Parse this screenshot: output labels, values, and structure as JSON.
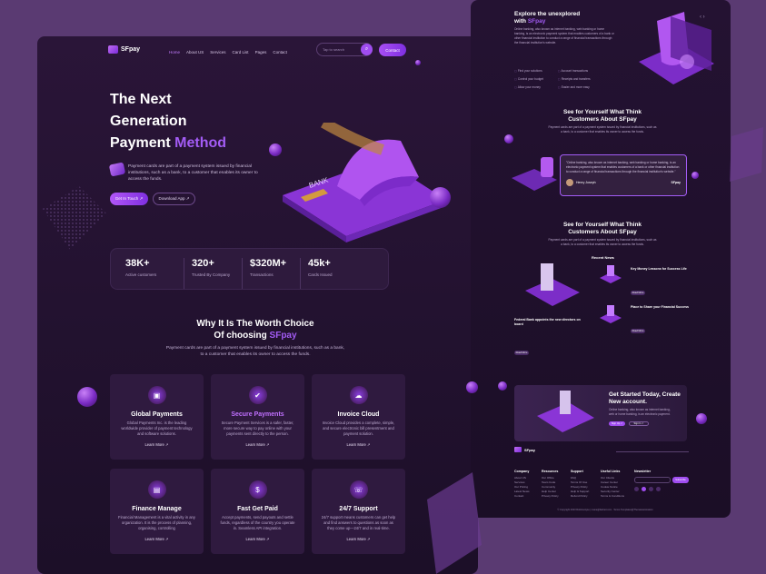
{
  "brand": "SFpay",
  "nav": {
    "items": [
      "Home",
      "About US",
      "Services",
      "Card List",
      "Pages",
      "Contact"
    ],
    "search_placeholder": "Tap to search",
    "contact": "Contact"
  },
  "hero": {
    "title_line1": "The Next",
    "title_line2": "Generation",
    "title_line3": "Payment",
    "title_hl": "Method",
    "desc": "Payment cards are part of a payment system issued by financial institutions, such as a bank, to a customer  that enables its owner to access the funds.",
    "btn_primary": "Get In Touch ↗",
    "btn_secondary": "Download App ↗",
    "card_label": "BANK"
  },
  "stats": [
    {
      "value": "38K+",
      "label": "Active customers"
    },
    {
      "value": "320+",
      "label": "Trusted By Company"
    },
    {
      "value": "$320M+",
      "label": "Transactions"
    },
    {
      "value": "45k+",
      "label": "Cards Issued"
    }
  ],
  "why": {
    "title_line1": "Why It Is The Worth Choice",
    "title_line2": "Of choosing",
    "title_hl": "SFpay",
    "desc": "Payment cards are part of a payment system issued by financial institutions, such as a bank, to a customer  that enables its owner to access the funds."
  },
  "features": [
    {
      "title": "Global Payments",
      "desc": "Global Payments Inc. is the leading worldwide provider of payment technology and software solutions.",
      "link": "Learn More ↗"
    },
    {
      "title": "Secure Payments",
      "desc": "Secure Payment Services is a safer, faster, more secure way to pay online with your payments sent directly to the person.",
      "link": "Learn More ↗"
    },
    {
      "title": "Invoice Cloud",
      "desc": "Invoice Cloud provides a complete, simple, and secure electronic bill presentment and payment solution.",
      "link": "Learn More ↗"
    },
    {
      "title": "Finance Manage",
      "desc": "Financial Management is a vital activity in any organization. It is the process of planning, organising, controlling",
      "link": "Learn More ↗"
    },
    {
      "title": "Fast Get Paid",
      "desc": "Accept payments, send payouts and settle funds, regardless of the country you operate in. Seamless API integration.",
      "link": "Learn More ↗"
    },
    {
      "title": "24/7 Support",
      "desc": "24/7 support means customers can get help and find answers to questions as soon as they come up—24/7 and in real-time.",
      "link": "Learn More ↗"
    }
  ],
  "right": {
    "explore_title1": "Explore the unexplored",
    "explore_title2": "with",
    "explore_hl": "SFpay",
    "explore_text": "Online banking, also known as internet banking, web banking or home banking, is an electronic payment system that enables customers of a bank or other financial institution to conduct a range of financial transactions through the financial institution's website.",
    "explore_list": [
      "Find your solutions",
      "Account transactions",
      "Control your budget",
      "Receipts and transfers",
      "Allow your money",
      "Easier and more easy"
    ],
    "see_title1": "See for Yourself What Think",
    "see_title2": "Customers About SFpay",
    "see_text": "Payment cards are part of a payment system issued by financial institutions, such as a bank, to a customer that enables its owner to access the funds.",
    "testi_text": "\"Online banking, also known as internet banking, web banking or home banking, is an electronic payment system that enables customers of a bank or other financial institution to conduct a range of financial transactions through the financial institution's website.\"",
    "testi_name": "Henry Joseph",
    "recent_news": "Recent News",
    "news": [
      {
        "title": "Key Money Lessons for Success Life"
      },
      {
        "title": "Place to Share your Financial Success"
      },
      {
        "title": "Federal Bank appoints the new directors on board"
      }
    ],
    "read_more": "Read More",
    "cta_title1": "Get Started Today, Create",
    "cta_title2": "New account.",
    "cta_text": "Online banking, also known as internet banking, web or home banking, is an electronic payment.",
    "cta_btn1": "Sign Up ↗",
    "cta_btn2": "Sign In ↗",
    "newsletter": "Newsletter",
    "footer_cols": [
      {
        "title": "Company",
        "items": [
          "About US",
          "Services",
          "Our Pricing",
          "Latest News",
          "Contact"
        ]
      },
      {
        "title": "Resources",
        "items": [
          "Our Office",
          "Team Code",
          "Community",
          "Help Center",
          "Privacy Policy"
        ]
      },
      {
        "title": "Support",
        "items": [
          "FAQ",
          "Terms Of Use",
          "Privacy Policy",
          "Help & Support",
          "Refund Policy"
        ]
      },
      {
        "title": "Useful Links",
        "items": [
          "Our Clients",
          "Career Center",
          "Cookie Notice",
          "Security Center",
          "Terms & Conditions"
        ]
      }
    ],
    "subscribe": "Subscribe",
    "copyright": "© Copyright 2023 Robinsonjoe | mane@fasheir.com . Terms Templates@ThemeHanimation"
  }
}
